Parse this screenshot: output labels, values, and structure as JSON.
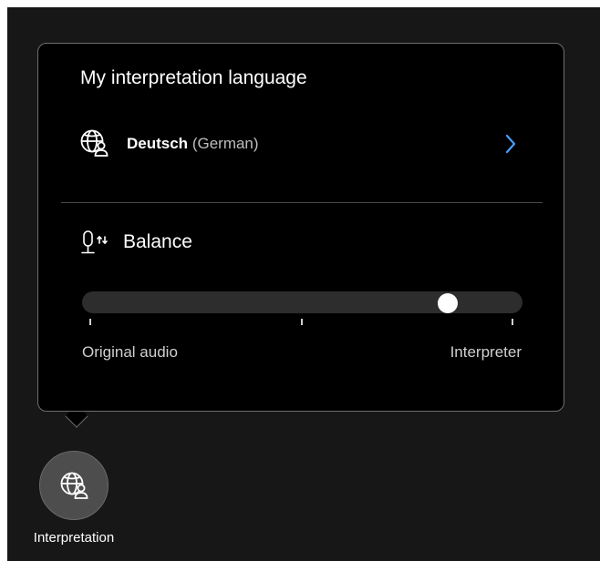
{
  "popover": {
    "title": "My interpretation language",
    "language": {
      "name": "Deutsch",
      "subtitle": "(German)",
      "icon": "globe-person-icon",
      "chevron_icon": "chevron-right-icon"
    },
    "balance": {
      "label": "Balance",
      "icon": "microphone-swap-icon",
      "value_fraction": 0.83,
      "left_label": "Original audio",
      "right_label": "Interpreter"
    }
  },
  "toolbar": {
    "interpretation_button": {
      "label": "Interpretation",
      "icon": "globe-person-icon"
    }
  },
  "colors": {
    "panel_background": "#000000",
    "page_background": "#171717",
    "accent_chevron": "#4a9eff",
    "button_background": "#4d4d4d"
  }
}
